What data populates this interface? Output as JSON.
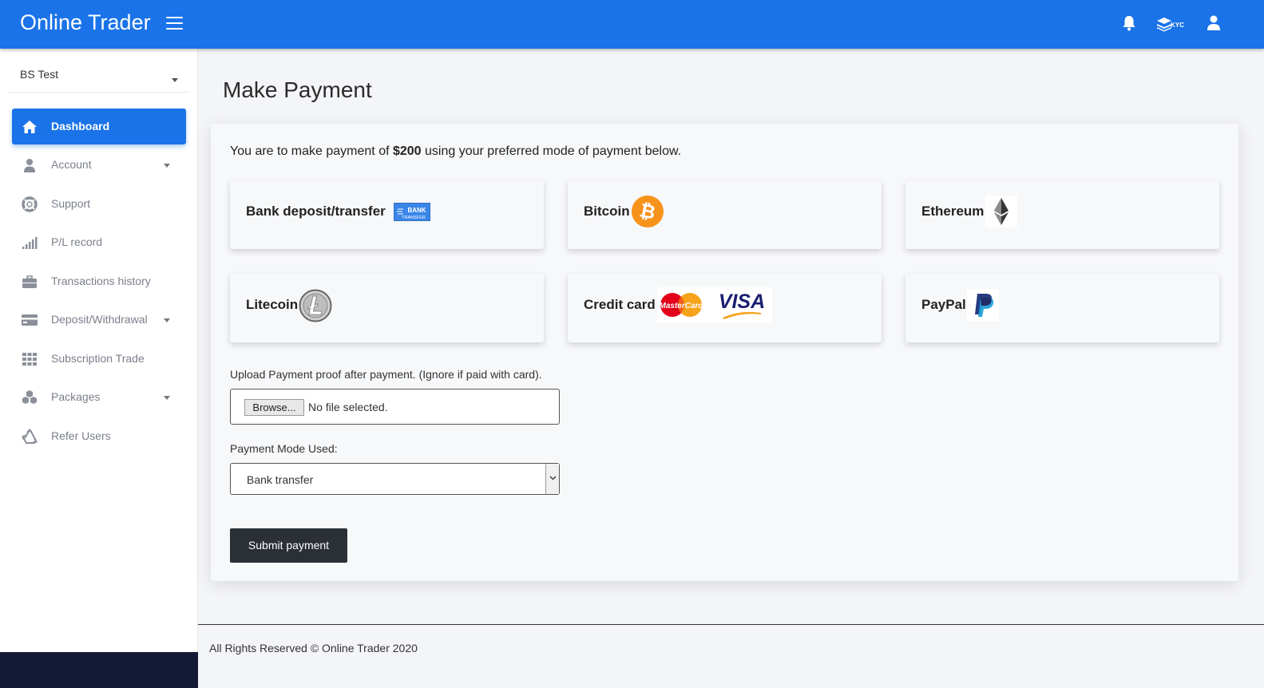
{
  "app": {
    "brand": "Online Trader"
  },
  "header": {
    "kyc_label": "KYC"
  },
  "sidebar": {
    "user_name": "BS Test",
    "items": [
      {
        "label": "Dashboard",
        "icon": "home-icon",
        "active": true
      },
      {
        "label": "Account",
        "icon": "user-icon",
        "has_caret": true
      },
      {
        "label": "Support",
        "icon": "lifebuoy-icon"
      },
      {
        "label": "P/L record",
        "icon": "signal-bars-icon"
      },
      {
        "label": "Transactions history",
        "icon": "briefcase-icon"
      },
      {
        "label": "Deposit/Withdrawal",
        "icon": "credit-card-icon",
        "has_caret": true
      },
      {
        "label": "Subscription Trade",
        "icon": "grid-icon"
      },
      {
        "label": "Packages",
        "icon": "cubes-icon",
        "has_caret": true
      },
      {
        "label": "Refer Users",
        "icon": "recycle-icon"
      }
    ]
  },
  "main": {
    "title": "Make Payment",
    "intro_before": "You are to make payment of ",
    "amount": "$200",
    "intro_after": " using your preferred mode of payment below.",
    "methods": [
      {
        "label": "Bank deposit/transfer",
        "logo": "bank-transfer-logo",
        "logo_text_1": "BANK",
        "logo_text_2": "TRANSFER"
      },
      {
        "label": "Bitcoin",
        "logo": "bitcoin-logo"
      },
      {
        "label": "Ethereum",
        "logo": "ethereum-logo"
      },
      {
        "label": "Litecoin",
        "logo": "litecoin-logo"
      },
      {
        "label": "Credit card",
        "logo": "mastercard-visa-logo",
        "mastercard_text": "MasterCard",
        "visa_text": "VISA"
      },
      {
        "label": "PayPal",
        "logo": "paypal-logo"
      }
    ],
    "upload_label": "Upload Payment proof after payment. (Ignore if paid with card).",
    "browse_label": "Browse...",
    "file_status": "No file selected.",
    "mode_label": "Payment Mode Used:",
    "mode_value": "Bank transfer",
    "submit_label": "Submit payment"
  },
  "footer": {
    "text": "All Rights Reserved © Online Trader 2020"
  },
  "colors": {
    "primary": "#1a73e8",
    "sidebar_bottom": "#141a35",
    "button_dark": "#2b2f36",
    "bitcoin": "#f7931a"
  }
}
